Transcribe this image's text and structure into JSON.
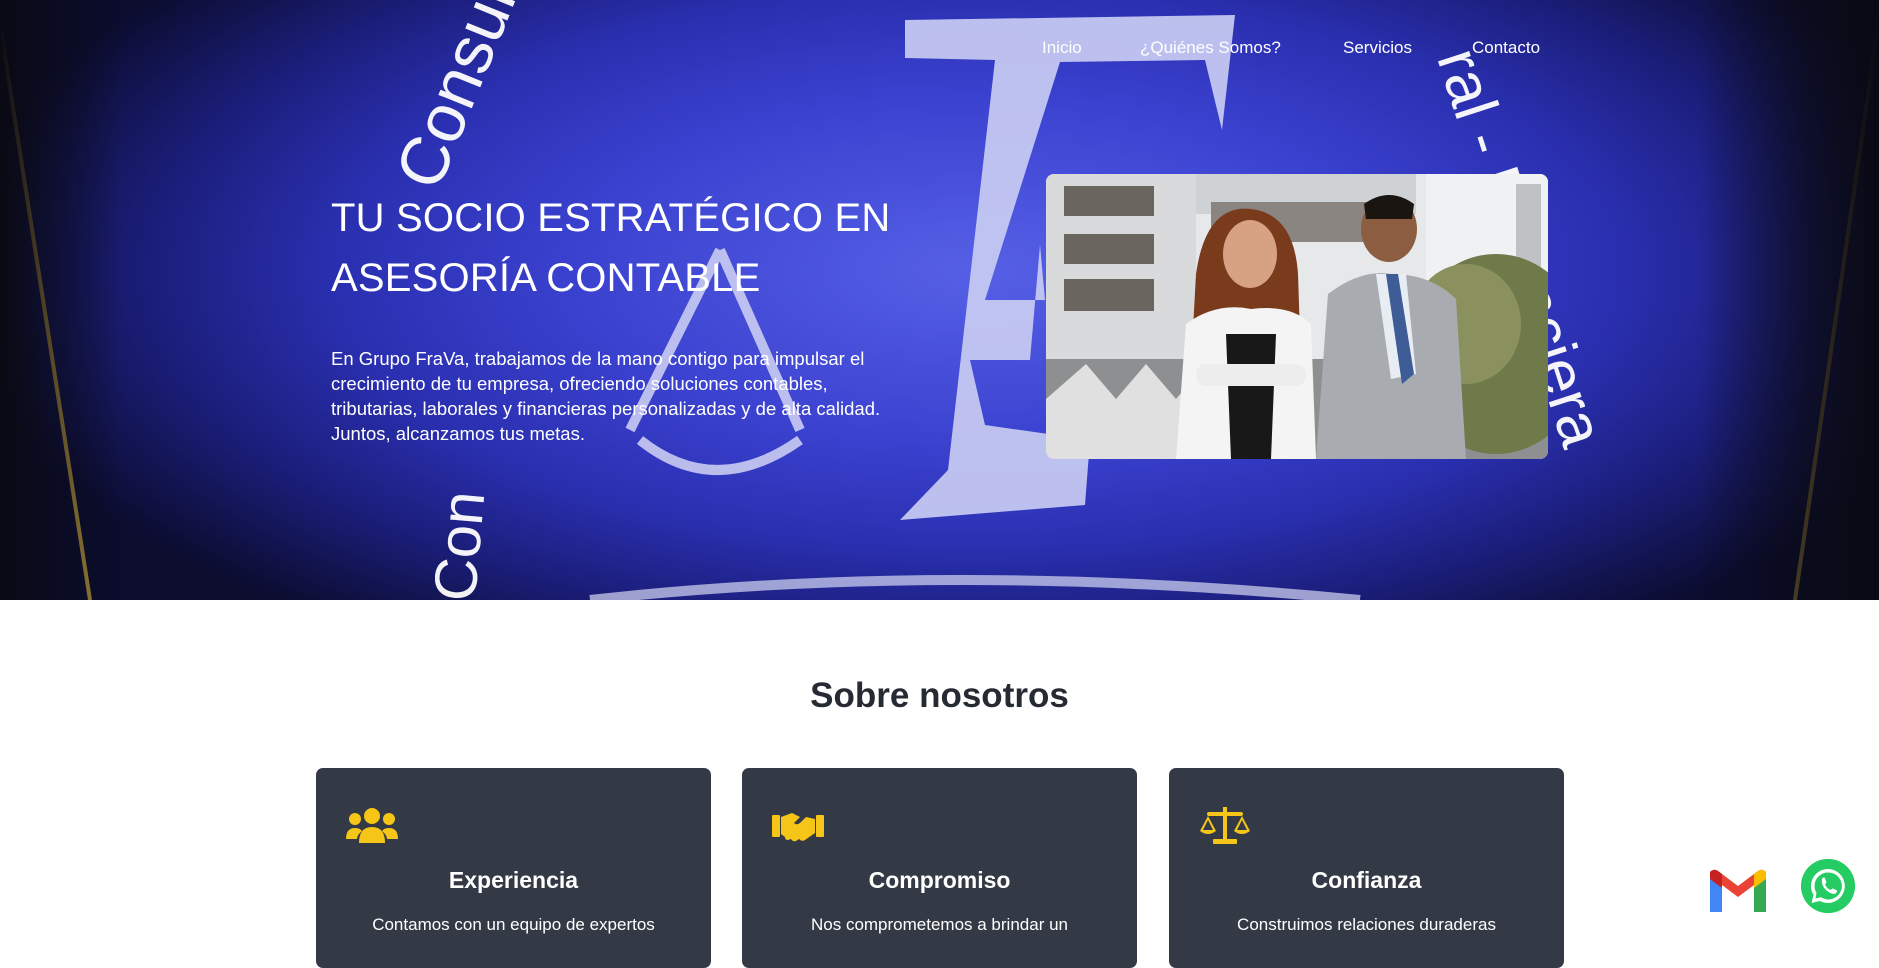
{
  "nav": {
    "items": [
      {
        "label": "Inicio"
      },
      {
        "label": "¿Quiénes Somos?"
      },
      {
        "label": "Servicios"
      },
      {
        "label": "Contacto"
      }
    ]
  },
  "hero": {
    "title": "TU SOCIO ESTRATÉGICO EN ASESORÍA CONTABLE",
    "description": "En Grupo FraVa, trabajamos de la mano contigo para impulsar el crecimiento de tu empresa, ofreciendo soluciones contables, tributarias, laborales y financieras personalizadas y de alta calidad. Juntos, alcanzamos tus metas.",
    "background_text_left": "Consultoría Con",
    "background_text_right": "ral - Financiera",
    "background_text_bottom": "Con",
    "accent_color": "#3b42d0"
  },
  "about": {
    "title": "Sobre nosotros",
    "cards": [
      {
        "icon": "users-icon",
        "title": "Experiencia",
        "text": "Contamos con un equipo de expertos"
      },
      {
        "icon": "handshake-icon",
        "title": "Compromiso",
        "text": "Nos comprometemos a brindar un"
      },
      {
        "icon": "scale-icon",
        "title": "Confianza",
        "text": "Construimos relaciones duraderas"
      }
    ],
    "card_color": "#343a45",
    "icon_color": "#f5c518"
  },
  "floating": {
    "mail_icon": "gmail-icon",
    "whatsapp_icon": "whatsapp-icon",
    "whatsapp_color": "#24cc63"
  }
}
